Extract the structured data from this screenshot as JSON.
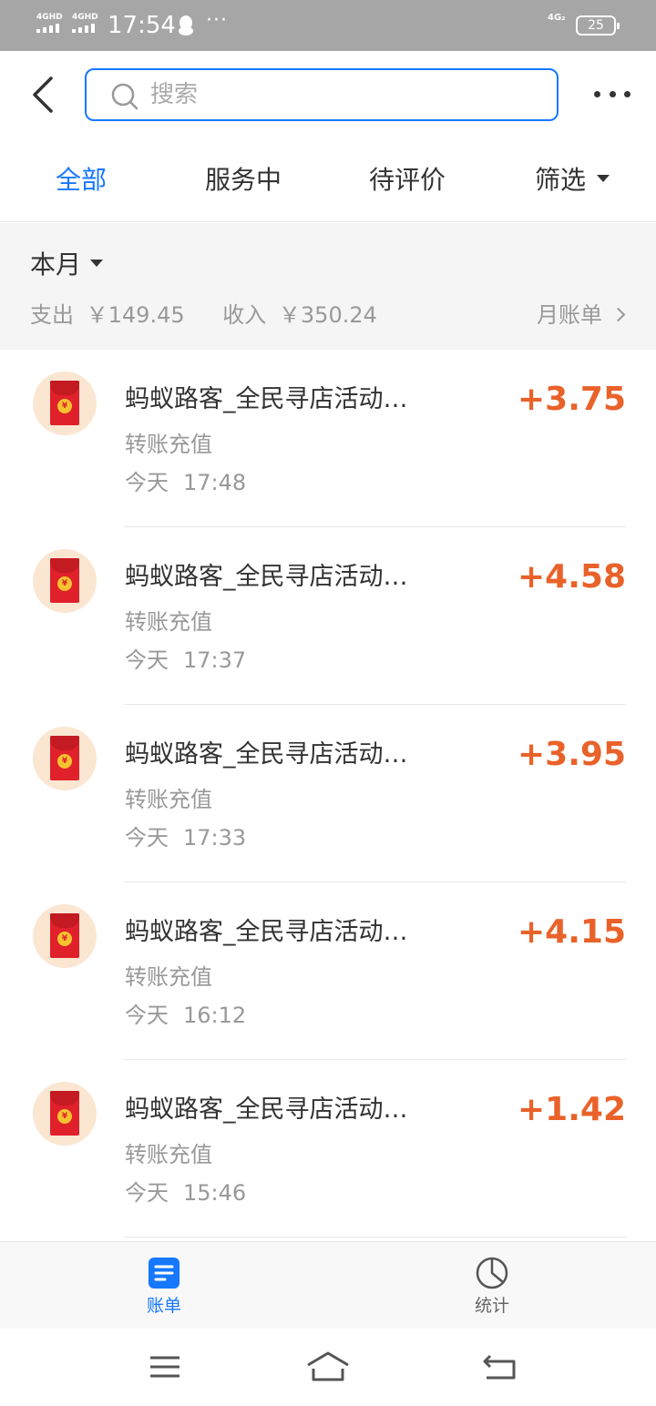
{
  "status_bar": {
    "signal1": "4GHD",
    "signal2": "4GHD",
    "time": "17:54",
    "more": "···",
    "network": "4G₂",
    "battery": "25"
  },
  "header": {
    "search_placeholder": "搜索",
    "icons": [
      "back-arrow-icon",
      "search-icon",
      "more-dots-icon"
    ]
  },
  "tabs": [
    {
      "label": "全部",
      "active": true
    },
    {
      "label": "服务中",
      "active": false
    },
    {
      "label": "待评价",
      "active": false
    },
    {
      "label": "筛选",
      "active": false
    }
  ],
  "summary": {
    "month": "本月",
    "expense_label": "支出",
    "expense_amount": "￥149.45",
    "income_label": "收入",
    "income_amount": "￥350.24",
    "monthly_bill": "月账单"
  },
  "items": [
    {
      "title": "蚂蚁路客_全民寻店活动…",
      "type": "转账充值",
      "day": "今天",
      "time": "17:48",
      "amount": "+3.75"
    },
    {
      "title": "蚂蚁路客_全民寻店活动…",
      "type": "转账充值",
      "day": "今天",
      "time": "17:37",
      "amount": "+4.58"
    },
    {
      "title": "蚂蚁路客_全民寻店活动…",
      "type": "转账充值",
      "day": "今天",
      "time": "17:33",
      "amount": "+3.95"
    },
    {
      "title": "蚂蚁路客_全民寻店活动…",
      "type": "转账充值",
      "day": "今天",
      "time": "16:12",
      "amount": "+4.15"
    },
    {
      "title": "蚂蚁路客_全民寻店活动…",
      "type": "转账充值",
      "day": "今天",
      "time": "15:46",
      "amount": "+1.42"
    }
  ],
  "bottom_tabs": [
    {
      "label": "账单",
      "icon": "bill-icon",
      "active": true
    },
    {
      "label": "统计",
      "icon": "pie-chart-icon",
      "active": false
    }
  ],
  "colors": {
    "accent": "#1677ff",
    "amount": "#e9622a",
    "secondary_text": "#999999",
    "status_bar": "#a6a6a6"
  }
}
